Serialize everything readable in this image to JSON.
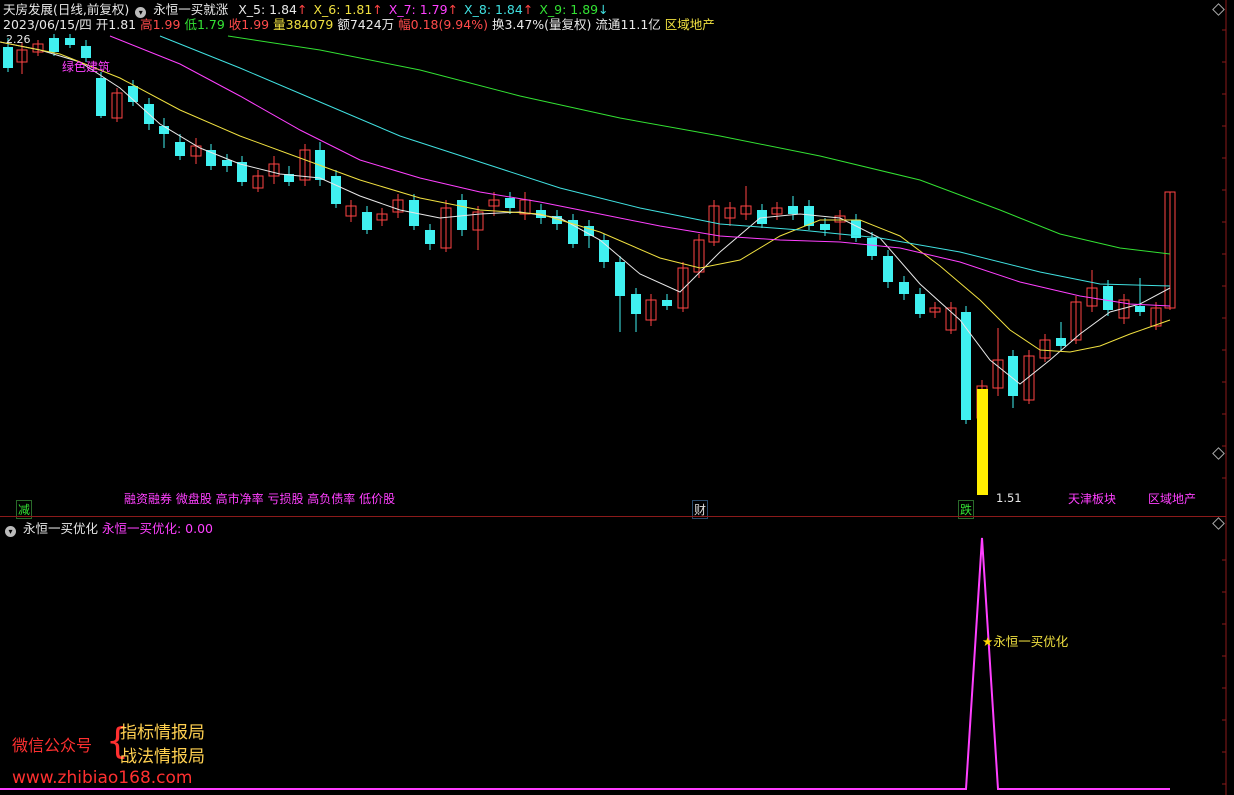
{
  "header": {
    "title": "天房发展(日线,前复权)",
    "indicator_name": "永恒一买就涨",
    "ma_items": [
      {
        "label": "X_5: 1.84",
        "arrow": "↑",
        "color": "#e8e8e8"
      },
      {
        "label": "X_6: 1.81",
        "arrow": "↑",
        "color": "#f0e040"
      },
      {
        "label": "X_7: 1.79",
        "arrow": "↑",
        "color": "#ff40ff"
      },
      {
        "label": "X_8: 1.84",
        "arrow": "↑",
        "color": "#40e0e0"
      },
      {
        "label": "X_9: 1.89",
        "arrow": "↓",
        "color": "#33e133"
      }
    ],
    "date": "2023/06/15/四",
    "open_label": "开",
    "open": "1.81",
    "high_label": "高",
    "high": "1.99",
    "low_label": "低",
    "low": "1.79",
    "close_label": "收",
    "close": "1.99",
    "volume_label": "量",
    "volume": "384079",
    "amount_label": "额",
    "amount": "7424万",
    "change_label": "幅",
    "change": "0.18(9.94%)",
    "turnover_label": "换",
    "turnover": "3.47%(量复权)",
    "float_label": "流通",
    "float": "11.1亿",
    "sector": "区域地产"
  },
  "main_chart": {
    "top_price_label": "2.26",
    "top_annotation": "绿色建筑",
    "low_price_label": "1.51",
    "tags": {
      "left_tag": "减",
      "concepts": "融资融券 微盘股 高市净率 亏损股 高负债率 低价股",
      "finance_tag": "财",
      "limit_tag": "跌",
      "region1": "天津板块",
      "region2": "区域地产"
    }
  },
  "sub_chart": {
    "title": "永恒一买优化",
    "value_label": "永恒一买优化: 0.00",
    "signal_label": "永恒一买优化",
    "signal_icon": "star-icon"
  },
  "watermark": {
    "label": "微信公众号",
    "line1": "指标情报局",
    "line2": "战法情报局",
    "site": "www.zhibiao168.com"
  },
  "chart_data": {
    "type": "candlestick",
    "visible_price_high": 2.26,
    "visible_price_low": 1.51,
    "last_bar": {
      "open": 1.81,
      "high": 1.99,
      "low": 1.79,
      "close": 1.99
    },
    "ma_last_values": {
      "X_5": 1.84,
      "X_6": 1.81,
      "X_7": 1.79,
      "X_8": 1.84,
      "X_9": 1.89
    },
    "signal_peak_value": null,
    "signal_current_value": 0.0
  },
  "colors": {
    "up": "#ff4444",
    "down": "#40f0f0",
    "signal": "#ff40ff",
    "volume_highlight": "#ffee00"
  }
}
